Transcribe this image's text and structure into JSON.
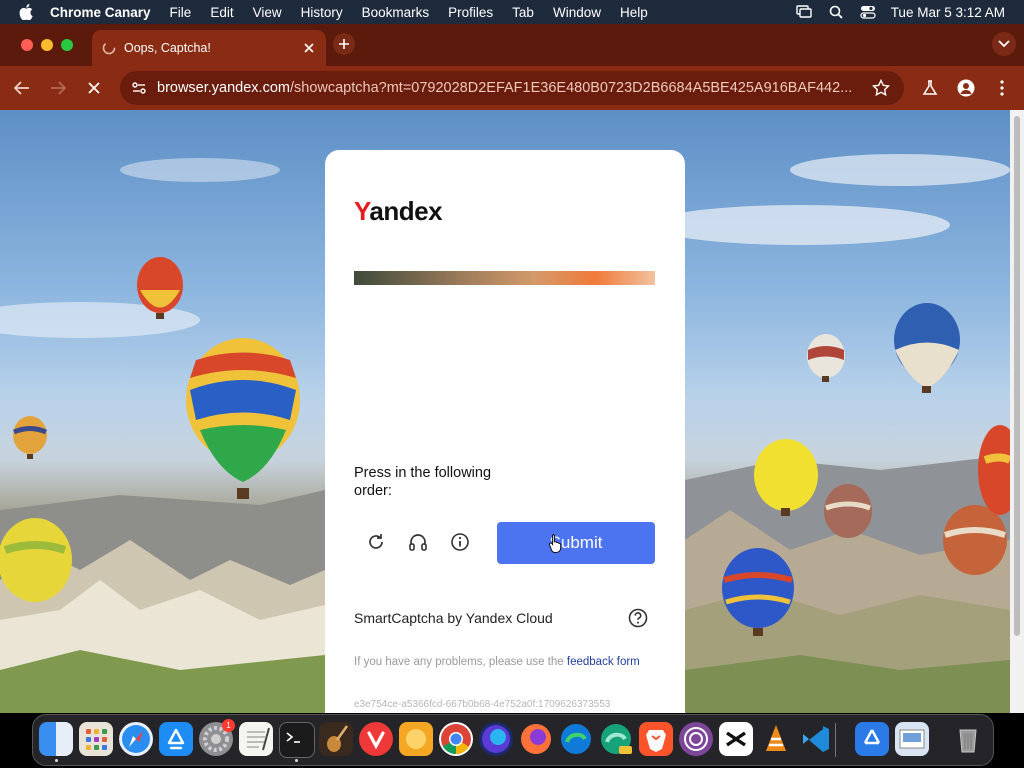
{
  "menubar": {
    "app_name": "Chrome Canary",
    "items": [
      "File",
      "Edit",
      "View",
      "History",
      "Bookmarks",
      "Profiles",
      "Tab",
      "Window",
      "Help"
    ],
    "clock": "Tue Mar 5  3:12 AM"
  },
  "tab": {
    "title": "Oops, Captcha!"
  },
  "toolbar": {
    "url_host": "browser.yandex.com",
    "url_path": "/showcaptcha?mt=0792028D2EFAF1E36E480B0723D2B6684A5BE425A916BAF442..."
  },
  "captcha": {
    "logo_first": "Y",
    "logo_rest": "andex",
    "instruction": "Press in the following order:",
    "submit_label": "Submit",
    "brand": "SmartCaptcha by Yandex Cloud",
    "problems_text": "If you have any problems, please use the ",
    "feedback_link": "feedback form",
    "request_id": "e3e754ce-a5366fcd-667b0b68-4e752a0f:1709626373553"
  },
  "dock": {
    "apps": [
      "Finder",
      "Launchpad",
      "Safari",
      "App Store",
      "System Settings",
      "TextEdit",
      "Terminal",
      "Instruments",
      "Vivaldi",
      "Pages",
      "Chrome",
      "Firefox Nightly",
      "Firefox",
      "Edge",
      "Edge Canary",
      "Brave",
      "Tor",
      "CapCut",
      "VLC",
      "VS Code",
      "Simulator",
      "Preview",
      "Trash"
    ],
    "settings_badge": "1"
  },
  "colors": {
    "tab_strip": "#5c1a0c",
    "toolbar": "#8a2c14",
    "submit": "#4c73f0",
    "yandex_red": "#e31e1e"
  }
}
